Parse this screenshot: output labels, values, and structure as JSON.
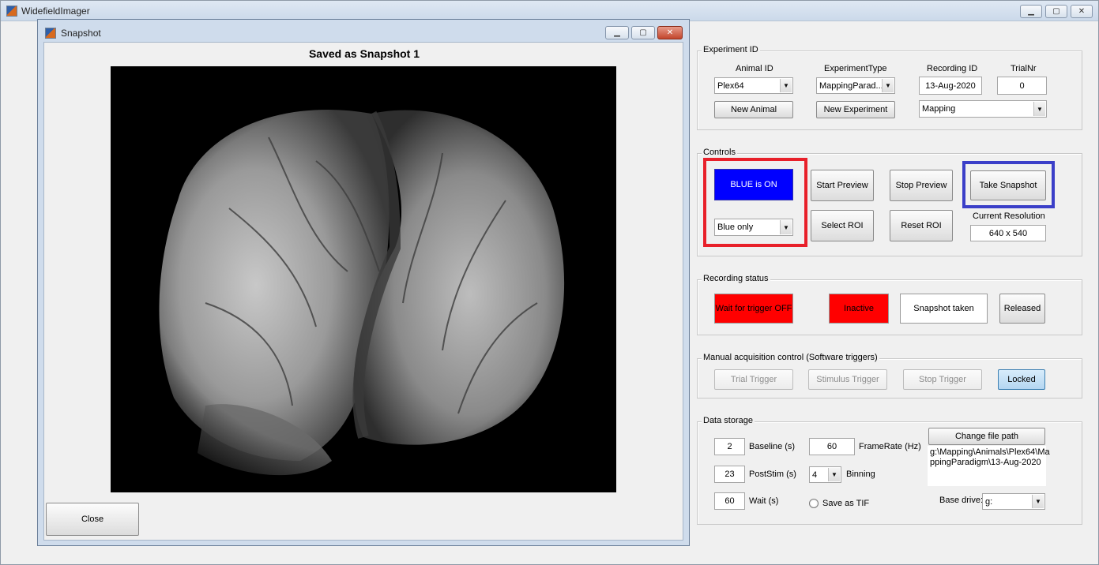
{
  "main_window": {
    "title": "WidefieldImager"
  },
  "snapshot_window": {
    "title": "Snapshot",
    "heading": "Saved as Snapshot 1",
    "close_label": "Close"
  },
  "window_controls": {
    "minimize": "▁",
    "maximize": "▢",
    "close": "✕"
  },
  "experiment_id": {
    "title": "Experiment ID",
    "animal_id_label": "Animal ID",
    "animal_id_value": "Plex64",
    "experiment_type_label": "ExperimentType",
    "experiment_type_value": "MappingParad...",
    "recording_id_label": "Recording ID",
    "recording_id_value": "13-Aug-2020",
    "trialnr_label": "TrialNr",
    "trialnr_value": "0",
    "new_animal_label": "New Animal",
    "new_experiment_label": "New Experiment",
    "recording_type_value": "Mapping"
  },
  "controls": {
    "title": "Controls",
    "blue_on_label": "BLUE is ON",
    "light_mode_value": "Blue only",
    "start_preview_label": "Start Preview",
    "stop_preview_label": "Stop Preview",
    "take_snapshot_label": "Take Snapshot",
    "select_roi_label": "Select ROI",
    "reset_roi_label": "Reset ROI",
    "current_resolution_label": "Current Resolution",
    "current_resolution_value": "640 x 540"
  },
  "recording_status": {
    "title": "Recording status",
    "trigger_status": "Wait for trigger OFF",
    "activity_status": "Inactive",
    "snapshot_status": "Snapshot taken",
    "release_label": "Released"
  },
  "manual_acquisition": {
    "title": "Manual acquisition control (Software triggers)",
    "trial_trigger_label": "Trial Trigger",
    "stimulus_trigger_label": "Stimulus Trigger",
    "stop_trigger_label": "Stop Trigger",
    "locked_label": "Locked"
  },
  "data_storage": {
    "title": "Data storage",
    "baseline_value": "2",
    "baseline_label": "Baseline (s)",
    "framerate_value": "60",
    "framerate_label": "FrameRate (Hz)",
    "poststim_value": "23",
    "poststim_label": "PostStim (s)",
    "binning_value": "4",
    "binning_label": "Binning",
    "wait_value": "60",
    "wait_label": "Wait (s)",
    "save_tif_label": "Save as TIF",
    "change_path_label": "Change file path",
    "file_path_line1": "g:\\Mapping\\Animals\\Plex64\\Ma",
    "file_path_line2": "ppingParadigm\\13-Aug-2020",
    "base_drive_label": "Base drive:",
    "base_drive_value": "g:"
  },
  "colors": {
    "blue_on": "#0000ff",
    "status_red": "#ff0000",
    "highlight_red": "#e8202a",
    "highlight_blue": "#3b3fc8",
    "locked_blue": "#c4dff5"
  },
  "icons": {
    "app": "matlab-logo-icon",
    "dropdown": "chevron-down-icon"
  }
}
